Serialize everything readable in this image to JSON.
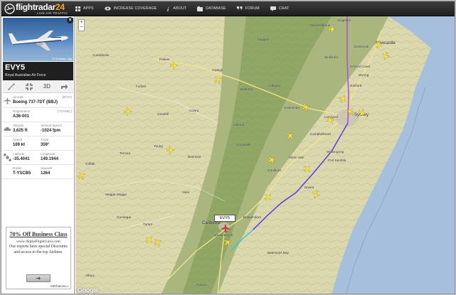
{
  "app": {
    "logo_text": "flightradar",
    "logo_number": "24",
    "logo_sub": "LIVE AIR TRAFFIC"
  },
  "nav": [
    {
      "label": "APPS",
      "icon": "grid-icon"
    },
    {
      "label": "INCREASE COVERAGE",
      "icon": "eye-icon"
    },
    {
      "label": "ABOUT",
      "icon": "info-icon"
    },
    {
      "label": "DATABASE",
      "icon": "database-icon"
    },
    {
      "label": "FORUM",
      "icon": "quote-icon"
    },
    {
      "label": "CHAT",
      "icon": "chat-icon"
    }
  ],
  "flight": {
    "photo_credit": "© Christian Jäg",
    "callsign": "EVY5",
    "operator": "Royal Australian Air Force",
    "action_3d": "3D",
    "aircraft_label": "Aircraft",
    "aircraft_code": "(B737)",
    "aircraft": "Boeing 737-7DT (BBJ)",
    "registration_label": "Registration",
    "registration_code": "(7CF85C)",
    "registration": "A36-001",
    "altitude_label": "Altitude",
    "altitude": "3,625 ft",
    "vspeed_label": "Vertical Speed",
    "vspeed": "-1024 fpm",
    "speed_label": "Speed",
    "speed": "169 kt",
    "track_label": "Track",
    "track": "359°",
    "latitude_label": "Latitude",
    "latitude": "-35.4041",
    "longitude_label": "Longitude",
    "longitude": "149.1944",
    "radar_label": "Radar",
    "radar": "T-YSCB5",
    "squawk_label": "Squawk",
    "squawk": "1264",
    "map_tag": "EVY5"
  },
  "ad": {
    "title": "70% Off Business Class",
    "url": "www.AlphaFlightGuru.com",
    "body": "Our experts have special Discounts and access to the top Airlines.",
    "button": "➜",
    "adchoices": "AdChoices ▷"
  },
  "map": {
    "zoom_in": "+",
    "zoom_out": "−",
    "google": "Google",
    "labels": [
      {
        "text": "Singleton",
        "big": false
      },
      {
        "text": "Muswellbrook",
        "big": false
      },
      {
        "text": "Cessnock",
        "big": false
      },
      {
        "text": "Newcastle",
        "big": true
      },
      {
        "text": "Central Coast",
        "big": false
      },
      {
        "text": "Wyong",
        "big": false
      },
      {
        "text": "Gosford",
        "big": false
      },
      {
        "text": "Sydney",
        "big": true
      },
      {
        "text": "Liverpool",
        "big": false
      },
      {
        "text": "Campbelltown",
        "big": false
      },
      {
        "text": "Wollongong",
        "big": false
      },
      {
        "text": "Port Kembla",
        "big": false
      },
      {
        "text": "Nowra",
        "big": false
      },
      {
        "text": "Goulburn",
        "big": false
      },
      {
        "text": "Bungendore",
        "big": false
      },
      {
        "text": "Canberra",
        "big": true
      },
      {
        "text": "Queanbeyan",
        "big": false
      },
      {
        "text": "Yass",
        "big": false
      },
      {
        "text": "Orange",
        "big": false
      },
      {
        "text": "Bathurst",
        "big": false
      },
      {
        "text": "Katoomba",
        "big": false
      },
      {
        "text": "Lithgow",
        "big": false
      },
      {
        "text": "Mudgee",
        "big": false
      },
      {
        "text": "Parkes",
        "big": false
      },
      {
        "text": "Forbes",
        "big": false
      },
      {
        "text": "Cowra",
        "big": false
      },
      {
        "text": "Young",
        "big": false
      },
      {
        "text": "Wagga Wagga",
        "big": false
      },
      {
        "text": "Tumut",
        "big": false
      },
      {
        "text": "Temora",
        "big": false
      },
      {
        "text": "Condobolin",
        "big": false
      },
      {
        "text": "Grenfell",
        "big": false
      },
      {
        "text": "Crookwell",
        "big": false
      },
      {
        "text": "Boorowa",
        "big": false
      },
      {
        "text": "Moss Vale",
        "big": false
      },
      {
        "text": "Batemans Bay",
        "big": false
      },
      {
        "text": "Cooma",
        "big": false
      },
      {
        "text": "Griffith",
        "big": false
      },
      {
        "text": "Wollombi",
        "big": false
      },
      {
        "text": "Gundagai",
        "big": false
      },
      {
        "text": "Oberon",
        "big": false
      },
      {
        "text": "Albury",
        "big": false
      }
    ]
  }
}
